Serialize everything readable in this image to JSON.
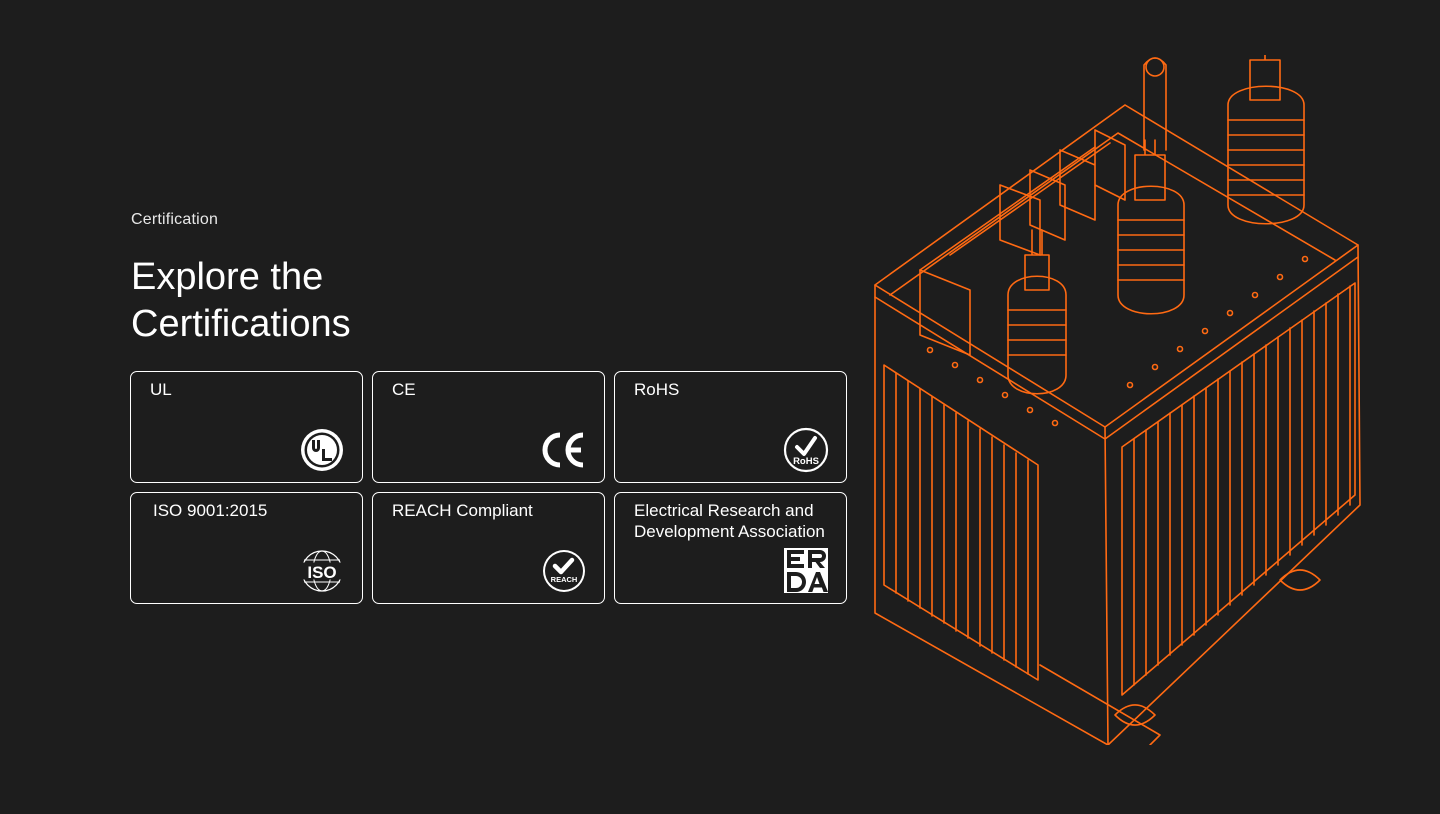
{
  "section": {
    "eyebrow": "Certification",
    "title_line1": "Explore the",
    "title_line2": "Certifications"
  },
  "certifications": [
    {
      "label": "UL",
      "icon": "ul-logo-icon"
    },
    {
      "label": "CE",
      "icon": "ce-logo-icon"
    },
    {
      "label": "RoHS",
      "icon": "rohs-logo-icon",
      "logo_text": "RoHS"
    },
    {
      "label": "ISO 9001:2015",
      "icon": "iso-logo-icon",
      "logo_text": "ISO"
    },
    {
      "label": "REACH Compliant",
      "icon": "reach-logo-icon",
      "logo_text": "REACH"
    },
    {
      "label": "Electrical Research and Development Association",
      "icon": "erda-logo-icon",
      "logo_text": "ERDA"
    }
  ],
  "colors": {
    "background": "#1d1d1d",
    "text": "#ffffff",
    "accent": "#ff6a13"
  },
  "illustration": {
    "icon": "transformer-wireframe-illustration"
  }
}
